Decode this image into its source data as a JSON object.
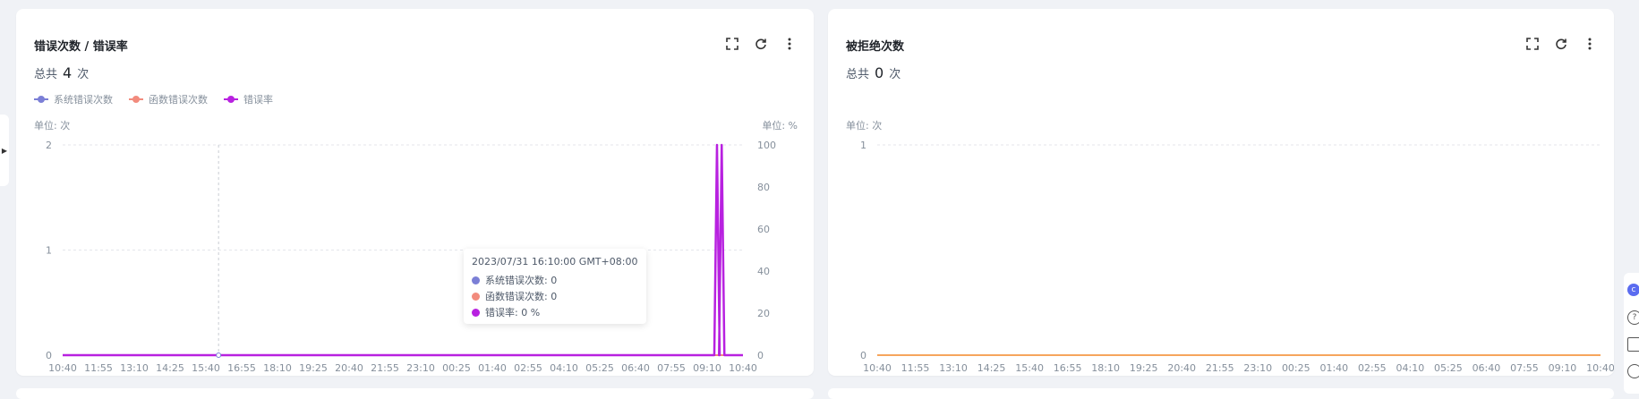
{
  "colors": {
    "sys": "#7b7fd6",
    "func": "#f28b7d",
    "rate": "#b821e0",
    "rejected": "#f6a55c"
  },
  "left_panel": {
    "title": "错误次数 / 错误率",
    "total_prefix": "总共",
    "total_value": "4",
    "total_suffix": "次",
    "legend": [
      "系统错误次数",
      "函数错误次数",
      "错误率"
    ],
    "unit_left": "单位: 次",
    "unit_right": "单位: %",
    "tooltip": {
      "time": "2023/07/31 16:10:00 GMT+08:00",
      "rows": [
        "系统错误次数: 0",
        "函数错误次数: 0",
        "错误率: 0 %"
      ]
    }
  },
  "right_panel": {
    "title": "被拒绝次数",
    "total_prefix": "总共",
    "total_value": "0",
    "total_suffix": "次",
    "unit_left": "单位: 次"
  },
  "toolbar_icons": [
    "fullscreen-icon",
    "refresh-icon",
    "more-icon"
  ],
  "chart_data": [
    {
      "type": "line",
      "x": [
        "10:40",
        "11:55",
        "13:10",
        "14:25",
        "15:40",
        "16:55",
        "18:10",
        "19:25",
        "20:40",
        "21:55",
        "23:10",
        "00:25",
        "01:40",
        "02:55",
        "04:10",
        "05:25",
        "06:40",
        "07:55",
        "09:10",
        "10:40"
      ],
      "y_left_ticks": [
        "0",
        "1",
        "2"
      ],
      "ylim_left": [
        0,
        2
      ],
      "y_right_ticks": [
        "0",
        "20",
        "40",
        "60",
        "80",
        "100"
      ],
      "ylim_right": [
        0,
        100
      ],
      "series": [
        {
          "name": "系统错误次数",
          "axis": "left",
          "values": [
            0
          ]
        },
        {
          "name": "函数错误次数",
          "axis": "left",
          "values": [
            0
          ]
        },
        {
          "name": "错误率",
          "axis": "right",
          "spikes": [
            {
              "x": "09:45",
              "value": 100
            },
            {
              "x": "09:55",
              "value": 100
            }
          ]
        }
      ],
      "tooltip_x": "16:10",
      "grid": true
    },
    {
      "type": "line",
      "x": [
        "10:40",
        "11:55",
        "13:10",
        "14:25",
        "15:40",
        "16:55",
        "18:10",
        "19:25",
        "20:40",
        "21:55",
        "23:10",
        "00:25",
        "01:40",
        "02:55",
        "04:10",
        "05:25",
        "06:40",
        "07:55",
        "09:10",
        "10:40"
      ],
      "y_left_ticks": [
        "0",
        "1"
      ],
      "ylim_left": [
        0,
        1
      ],
      "series": [
        {
          "name": "被拒绝次数",
          "values": [
            0
          ]
        }
      ],
      "grid": true
    }
  ]
}
